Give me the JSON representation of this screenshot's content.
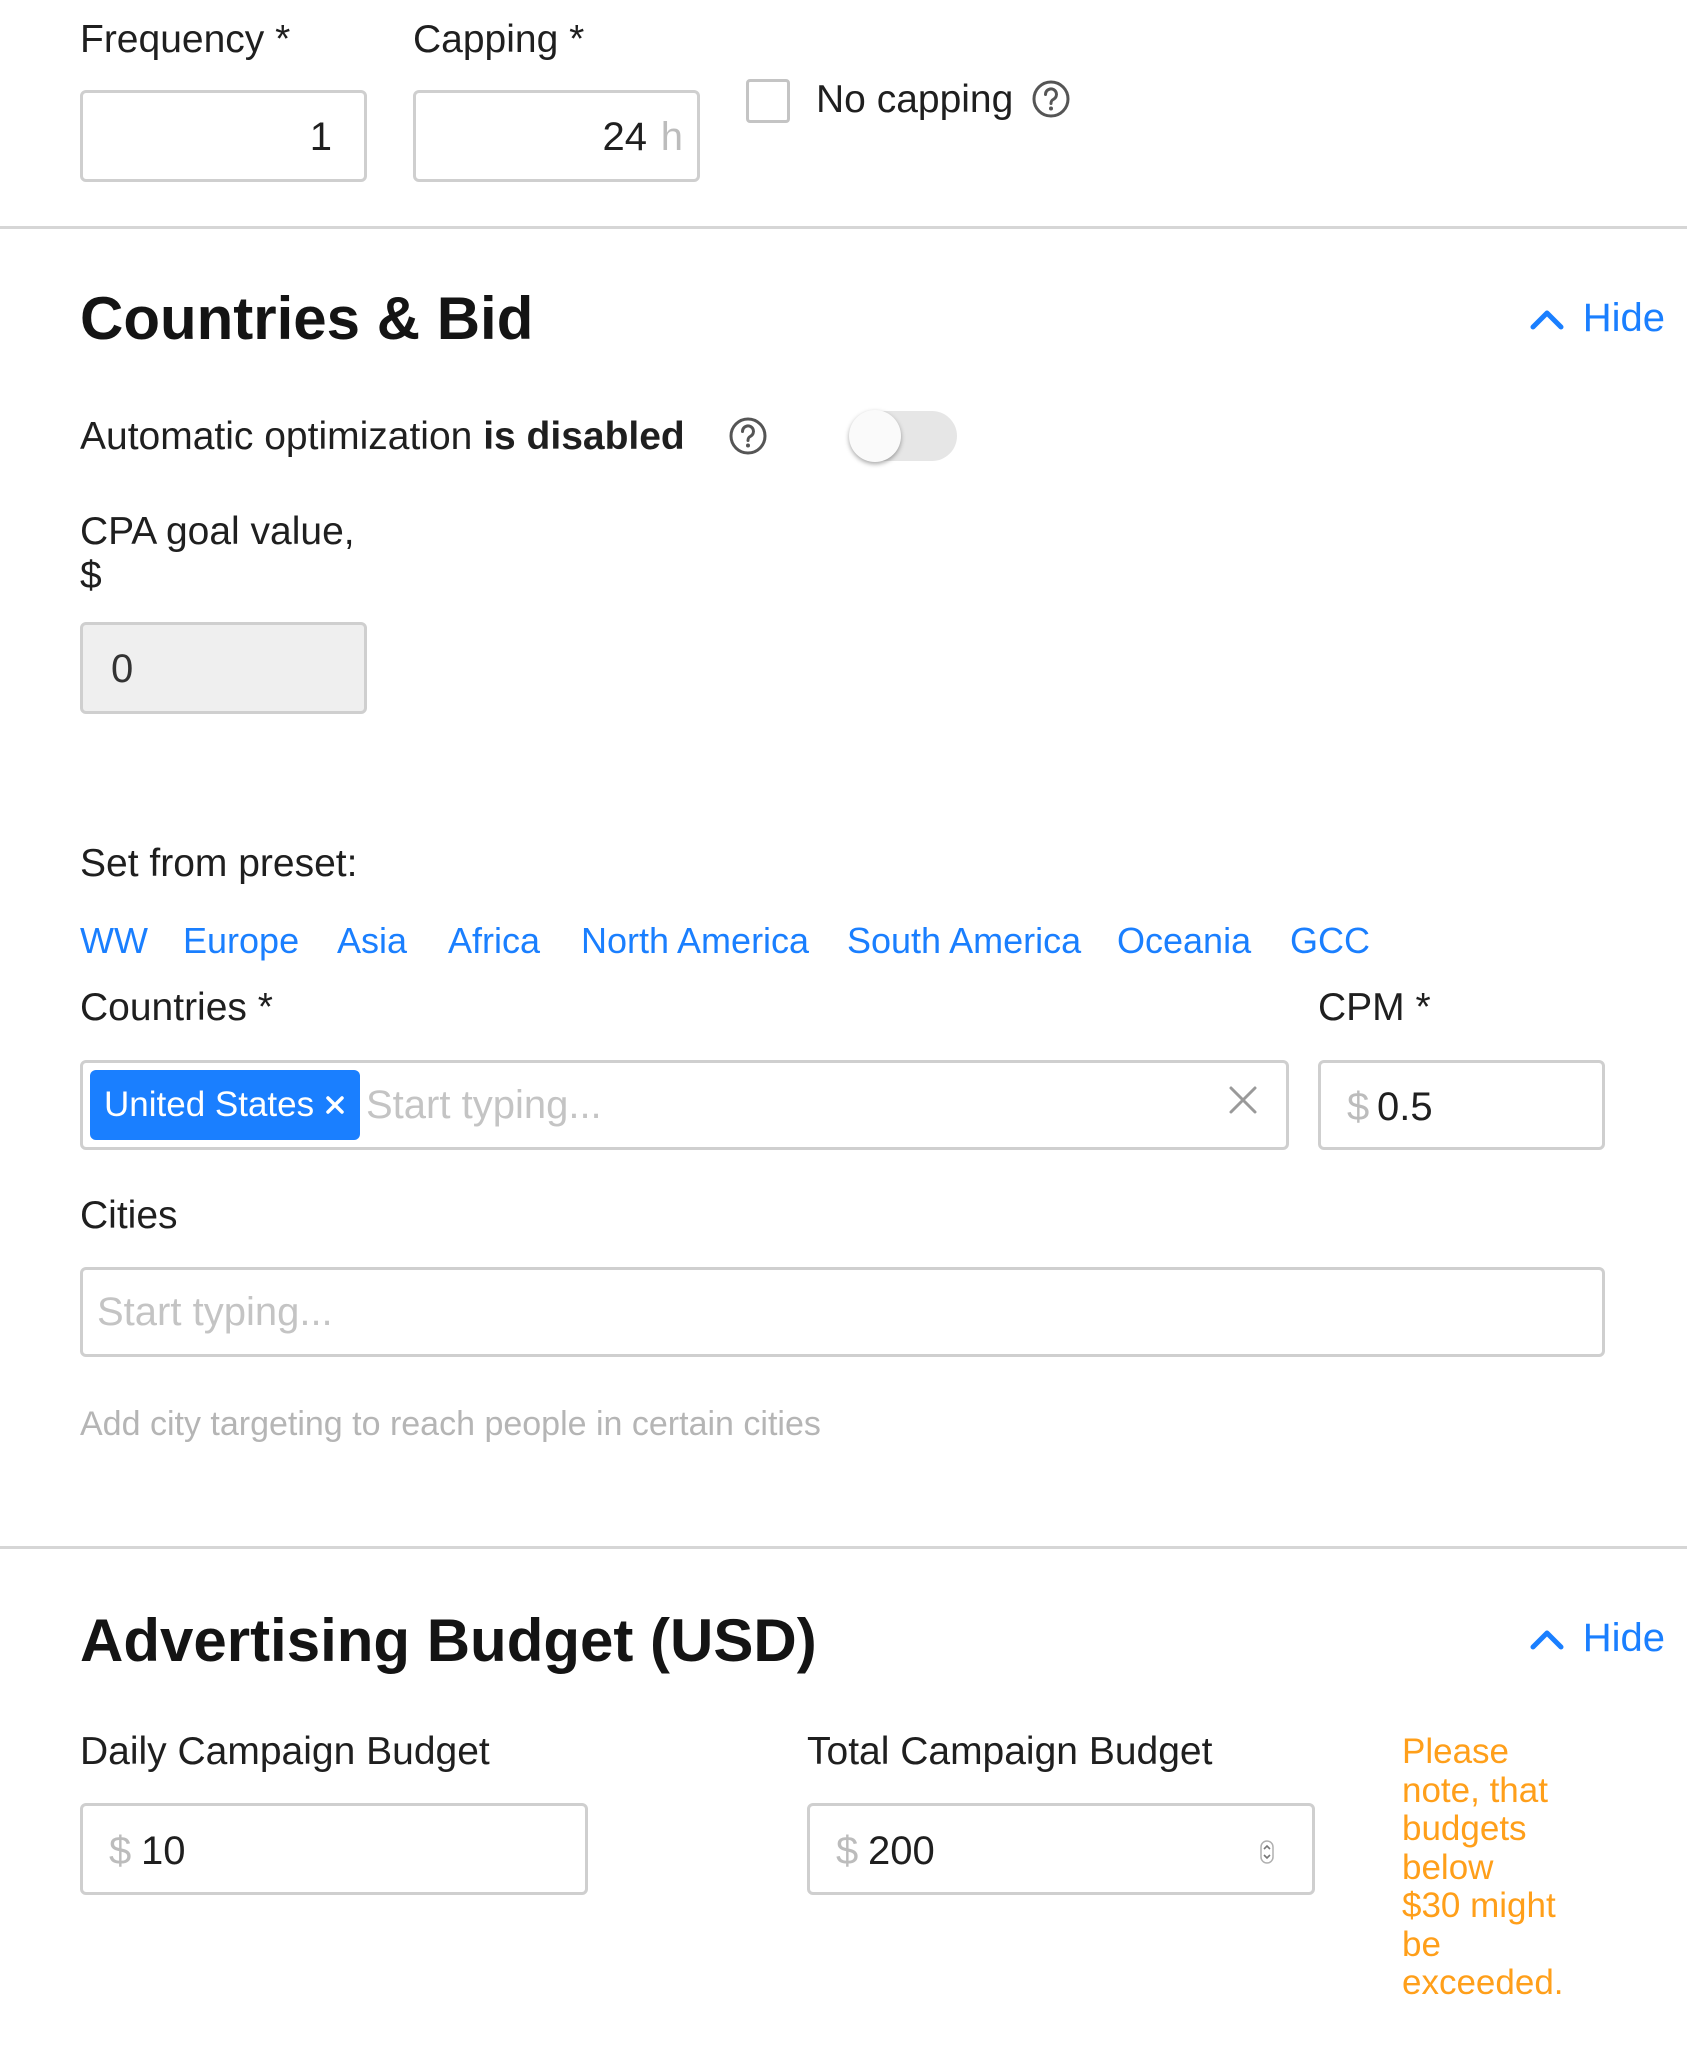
{
  "frequency": {
    "label": "Frequency *",
    "value": "1"
  },
  "capping": {
    "label": "Capping *",
    "value": "24",
    "unit": "h"
  },
  "no_capping": {
    "label": "No capping",
    "checked": false
  },
  "countries_bid": {
    "title": "Countries & Bid",
    "hide_label": "Hide",
    "auto_opt_prefix": "Automatic optimization",
    "auto_opt_state": "is disabled",
    "auto_opt_enabled": false,
    "cpa_label_line1": "CPA goal value,",
    "cpa_label_line2": "$",
    "cpa_value": "0",
    "preset_label": "Set from preset:",
    "presets": [
      "WW",
      "Europe",
      "Asia",
      "Africa",
      "North America",
      "South America",
      "Oceania",
      "GCC"
    ],
    "countries_label": "Countries *",
    "selected_country": "United States",
    "countries_placeholder": "Start typing...",
    "cpm_label": "CPM *",
    "cpm_currency": "$",
    "cpm_value": "0.5",
    "cities_label": "Cities",
    "cities_placeholder": "Start typing...",
    "cities_hint": "Add city targeting to reach people in certain cities"
  },
  "budget": {
    "title": "Advertising Budget (USD)",
    "hide_label": "Hide",
    "daily_label": "Daily Campaign Budget",
    "daily_currency": "$",
    "daily_value": "10",
    "total_label": "Total Campaign Budget",
    "total_currency": "$",
    "total_value": "200",
    "note_lines": [
      "Please",
      "note, that",
      "budgets",
      "below",
      "$30 might",
      "be",
      "exceeded."
    ]
  },
  "colors": {
    "accent": "#1a7fff",
    "warning": "#ff9f1a",
    "border": "#cfcfcf",
    "disabled_bg": "#efefef"
  },
  "icons": {
    "help": "question-circle-icon",
    "hide": "chevron-up-icon",
    "remove_tag": "close-icon",
    "clear": "clear-x-icon",
    "spinner": "spinner-arrows-icon"
  }
}
